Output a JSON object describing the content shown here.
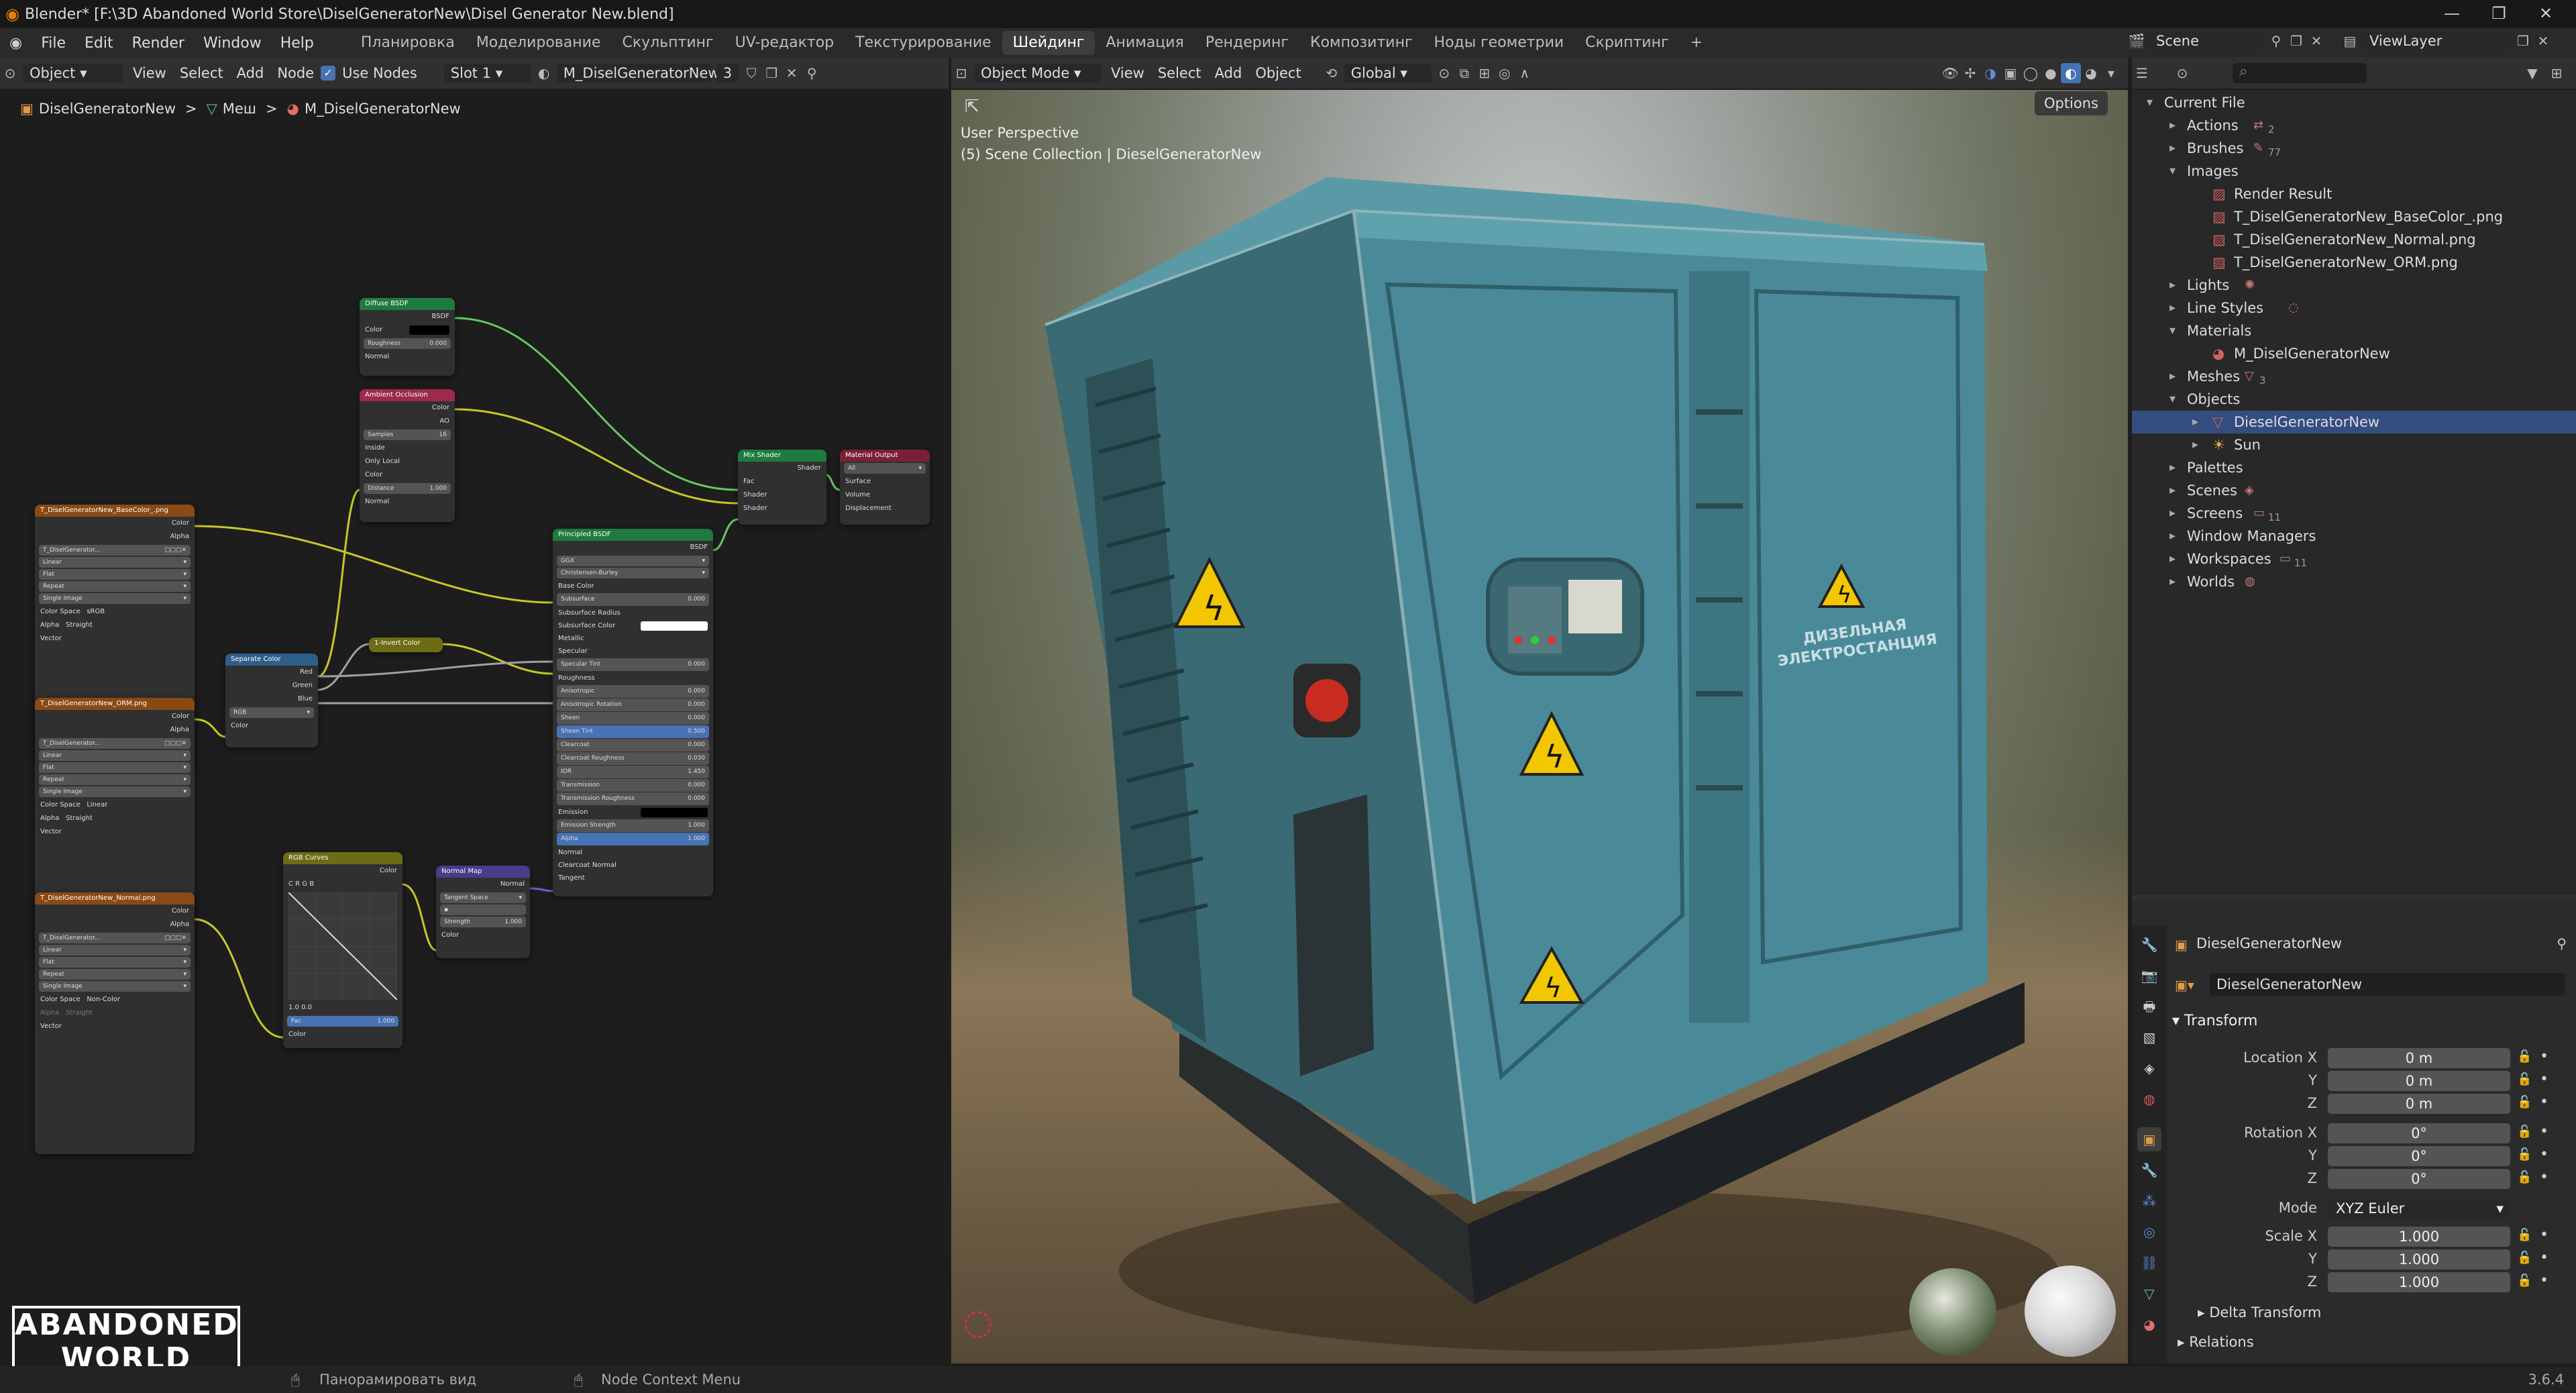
{
  "titlebar": {
    "title": "Blender* [F:\\3D Abandoned World Store\\DiselGeneratorNew\\Disel Generator New.blend]",
    "minimize": "—",
    "maximize": "❐",
    "close": "✕"
  },
  "topbar": {
    "menus": [
      "File",
      "Edit",
      "Render",
      "Window",
      "Help"
    ],
    "workspaces": [
      "Планировка",
      "Моделирование",
      "Скульптинг",
      "UV-редактор",
      "Текстурирование",
      "Шейдинг",
      "Анимация",
      "Рендеринг",
      "Композитинг",
      "Ноды геометрии",
      "Скриптинг"
    ],
    "active_workspace": "Шейдинг",
    "add_ws": "+",
    "scene_label": "Scene",
    "viewlayer_label": "ViewLayer"
  },
  "node_header": {
    "object_mode": "Object",
    "menus": [
      "View",
      "Select",
      "Add",
      "Node"
    ],
    "use_nodes": "Use Nodes",
    "slot": "Slot 1",
    "material": "M_DiselGeneratorNew",
    "users": "3"
  },
  "breadcrumb": {
    "object": "DiselGeneratorNew",
    "mesh": "Меш",
    "material": "M_DiselGeneratorNew",
    "sep": ">"
  },
  "nodes": {
    "diffuse": {
      "title": "Diffuse BSDF",
      "out": "BSDF",
      "color": "Color",
      "roughness": "Roughness",
      "roughness_val": "0.000",
      "normal": "Normal"
    },
    "ao": {
      "title": "Ambient Occlusion",
      "out_color": "Color",
      "out_ao": "AO",
      "samples": "Samples",
      "samples_val": "16",
      "inside": "Inside",
      "only_local": "Only Local",
      "color": "Color",
      "distance": "Distance",
      "distance_val": "1.000",
      "normal": "Normal"
    },
    "mix": {
      "title": "Mix Shader",
      "out": "Shader",
      "fac": "Fac",
      "shader1": "Shader",
      "shader2": "Shader"
    },
    "output": {
      "title": "Material Output",
      "target": "All",
      "surface": "Surface",
      "volume": "Volume",
      "displacement": "Displacement"
    },
    "basecolor": {
      "title": "T_DiselGeneratorNew_BaseColor_.png",
      "out_color": "Color",
      "out_alpha": "Alpha",
      "image": "T_DiselGenerator...",
      "interp": "Linear",
      "proj": "Flat",
      "ext": "Repeat",
      "source": "Single Image",
      "cs_label": "Color Space",
      "cs_val": "sRGB",
      "alpha_label": "Alpha",
      "alpha_val": "Straight",
      "vector": "Vector"
    },
    "orm": {
      "title": "T_DiselGeneratorNew_ORM.png",
      "out_color": "Color",
      "out_alpha": "Alpha",
      "image": "T_DiselGenerator...",
      "interp": "Linear",
      "proj": "Flat",
      "ext": "Repeat",
      "source": "Single Image",
      "cs_label": "Color Space",
      "cs_val": "Linear",
      "alpha_label": "Alpha",
      "alpha_val": "Straight",
      "vector": "Vector"
    },
    "normaltex": {
      "title": "T_DiselGeneratorNew_Normal.png",
      "out_color": "Color",
      "out_alpha": "Alpha",
      "image": "T_DiselGenerator...",
      "interp": "Linear",
      "proj": "Flat",
      "ext": "Repeat",
      "source": "Single Image",
      "cs_label": "Color Space",
      "cs_val": "Non-Color",
      "alpha_label": "Alpha",
      "alpha_val": "Straight",
      "vector": "Vector"
    },
    "separate": {
      "title": "Separate Color",
      "red": "Red",
      "green": "Green",
      "blue": "Blue",
      "mode": "RGB",
      "color": "Color"
    },
    "invert": {
      "title": "1-Invert Color"
    },
    "curves": {
      "title": "RGB Curves",
      "out": "Color",
      "chans": "C R G B",
      "vals": "1.0   0.0",
      "fac": "Fac",
      "fac_val": "1.000",
      "color": "Color"
    },
    "normalmap": {
      "title": "Normal Map",
      "out": "Normal",
      "space": "Tangent Space",
      "strength": "Strength",
      "strength_val": "1.000",
      "color": "Color"
    },
    "principled": {
      "title": "Principled BSDF",
      "out": "BSDF",
      "dist": "GGX",
      "sss_method": "Christensen-Burley",
      "rows": [
        [
          "Base Color",
          ""
        ],
        [
          "Subsurface",
          "0.000"
        ],
        [
          "Subsurface Radius",
          ""
        ],
        [
          "Subsurface Color",
          ""
        ],
        [
          "Metallic",
          ""
        ],
        [
          "Specular",
          ""
        ],
        [
          "Specular Tint",
          "0.000"
        ],
        [
          "Roughness",
          ""
        ],
        [
          "Anisotropic",
          "0.000"
        ],
        [
          "Anisotropic Rotation",
          "0.000"
        ],
        [
          "Sheen",
          "0.000"
        ],
        [
          "Sheen Tint",
          "0.500"
        ],
        [
          "Clearcoat",
          "0.000"
        ],
        [
          "Clearcoat Roughness",
          "0.030"
        ],
        [
          "IOR",
          "1.450"
        ],
        [
          "Transmission",
          "0.000"
        ],
        [
          "Transmission Roughness",
          "0.000"
        ],
        [
          "Emission",
          ""
        ],
        [
          "Emission Strength",
          "1.000"
        ],
        [
          "Alpha",
          "1.000"
        ],
        [
          "Normal",
          ""
        ],
        [
          "Clearcoat Normal",
          ""
        ],
        [
          "Tangent",
          ""
        ]
      ]
    }
  },
  "watermark": {
    "line1": "ABANDONED",
    "line2": "WORLD"
  },
  "viewport_header": {
    "mode": "Object Mode",
    "menus": [
      "View",
      "Select",
      "Add",
      "Object"
    ],
    "orientation": "Global",
    "options": "Options"
  },
  "viewport": {
    "perspective": "User Perspective",
    "collection": "(5) Scene Collection | DieselGeneratorNew",
    "sign_text_1": "ДИЗЕЛЬНАЯ",
    "sign_text_2": "ЭЛЕКТРОСТАНЦИЯ"
  },
  "outliner": {
    "search_placeholder": "",
    "rows": [
      {
        "label": "Current File",
        "indent": 0,
        "arrow": "▾",
        "extra": ""
      },
      {
        "label": "Actions",
        "indent": 1,
        "arrow": "▸",
        "extra": "2"
      },
      {
        "label": "Brushes",
        "indent": 1,
        "arrow": "▸",
        "extra": "77"
      },
      {
        "label": "Images",
        "indent": 1,
        "arrow": "▾",
        "extra": ""
      },
      {
        "label": "Render Result",
        "indent": 2,
        "arrow": "",
        "extra": ""
      },
      {
        "label": "T_DiselGeneratorNew_BaseColor_.png",
        "indent": 2,
        "arrow": "",
        "extra": ""
      },
      {
        "label": "T_DiselGeneratorNew_Normal.png",
        "indent": 2,
        "arrow": "",
        "extra": ""
      },
      {
        "label": "T_DiselGeneratorNew_ORM.png",
        "indent": 2,
        "arrow": "",
        "extra": ""
      },
      {
        "label": "Lights",
        "indent": 1,
        "arrow": "▸",
        "extra": ""
      },
      {
        "label": "Line Styles",
        "indent": 1,
        "arrow": "▸",
        "extra": ""
      },
      {
        "label": "Materials",
        "indent": 1,
        "arrow": "▾",
        "extra": ""
      },
      {
        "label": "M_DiselGeneratorNew",
        "indent": 2,
        "arrow": "",
        "extra": ""
      },
      {
        "label": "Meshes",
        "indent": 1,
        "arrow": "▸",
        "extra": "3"
      },
      {
        "label": "Objects",
        "indent": 1,
        "arrow": "▾",
        "extra": ""
      },
      {
        "label": "DieselGeneratorNew",
        "indent": 2,
        "arrow": "▸",
        "extra": "",
        "selected": true
      },
      {
        "label": "Sun",
        "indent": 2,
        "arrow": "▸",
        "extra": ""
      },
      {
        "label": "Palettes",
        "indent": 1,
        "arrow": "▸",
        "extra": ""
      },
      {
        "label": "Scenes",
        "indent": 1,
        "arrow": "▸",
        "extra": ""
      },
      {
        "label": "Screens",
        "indent": 1,
        "arrow": "▸",
        "extra": "11"
      },
      {
        "label": "Window Managers",
        "indent": 1,
        "arrow": "▸",
        "extra": ""
      },
      {
        "label": "Workspaces",
        "indent": 1,
        "arrow": "▸",
        "extra": "11"
      },
      {
        "label": "Worlds",
        "indent": 1,
        "arrow": "▸",
        "extra": ""
      }
    ]
  },
  "properties": {
    "object_name": "DieselGeneratorNew",
    "name_field": "DieselGeneratorNew",
    "transform": "Transform",
    "location_x_label": "Location X",
    "y": "Y",
    "z": "Z",
    "location": [
      "0 m",
      "0 m",
      "0 m"
    ],
    "rotation_x_label": "Rotation X",
    "rotation": [
      "0°",
      "0°",
      "0°"
    ],
    "mode_label": "Mode",
    "mode_val": "XYZ Euler",
    "scale_x_label": "Scale X",
    "scale": [
      "1.000",
      "1.000",
      "1.000"
    ],
    "delta": "Delta Transform",
    "relations": "Relations"
  },
  "statusbar": {
    "pan": "Панорамировать вид",
    "context": "Node Context Menu",
    "version": "3.6.4"
  },
  "colors": {
    "accent": "#4772b3",
    "selected_row": "#334d80",
    "shader_header": "#1e7a3e",
    "texture_header": "#8a4a14",
    "converter_header": "#2e5f8a",
    "color_header": "#6c6c16",
    "vector_header": "#4a3b8c",
    "output_header": "#7a2035",
    "ao_header": "#9c2a4a",
    "generator": "#4a8a98"
  }
}
